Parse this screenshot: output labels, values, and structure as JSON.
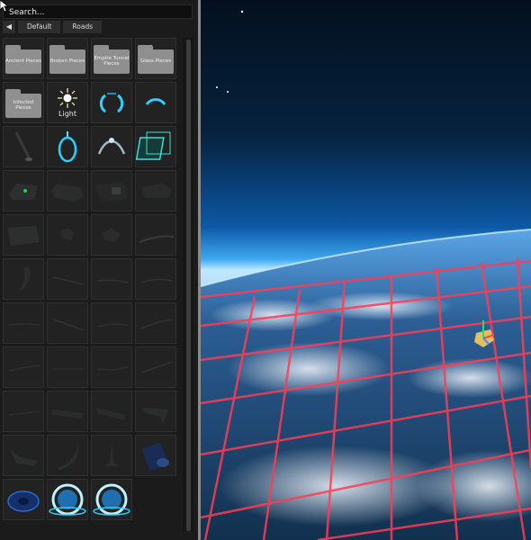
{
  "search": {
    "placeholder": "Search..."
  },
  "breadcrumbs": {
    "back_icon": "back-arrow-icon",
    "items": [
      "Default",
      "Roads"
    ]
  },
  "folders": [
    {
      "label": "Ancient Pieces"
    },
    {
      "label": "Broken Pieces"
    },
    {
      "label": "Empire Tunnel Pieces"
    },
    {
      "label": "Glass Pieces"
    },
    {
      "label": "Infected Pieces"
    }
  ],
  "light": {
    "label": "Light",
    "icon": "sun-icon"
  },
  "colors": {
    "accent": "#2fd0ff",
    "grid_line": "#ff3c55",
    "panel": "#1b1b1b"
  }
}
